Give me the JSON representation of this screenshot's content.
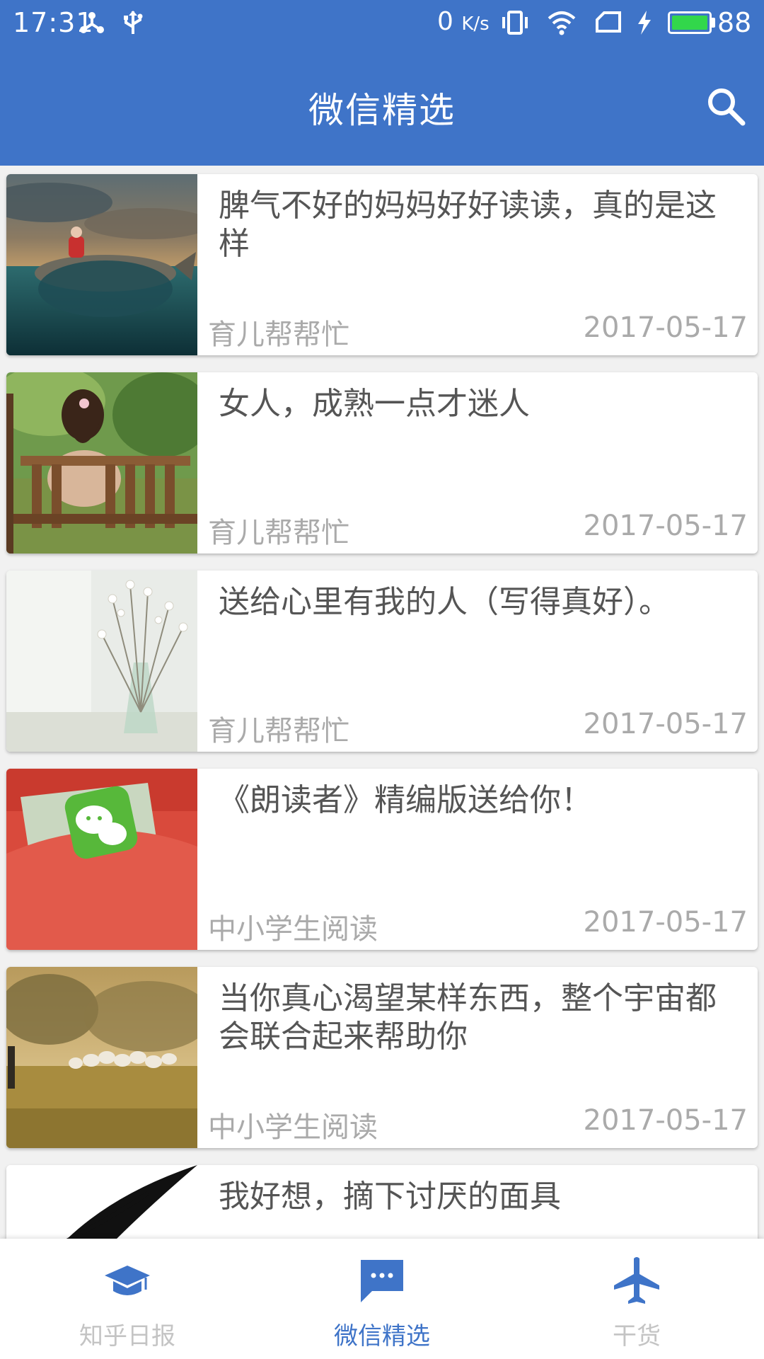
{
  "status_bar": {
    "time": "17:31",
    "net_speed_value": "0",
    "net_speed_unit": "K/s",
    "battery_level": "88",
    "icons": [
      "share-nodes-icon",
      "usb-icon",
      "vibrate-icon",
      "wifi-icon",
      "no-sim-icon",
      "charging-icon",
      "battery-icon"
    ]
  },
  "app_bar": {
    "title": "微信精选",
    "search_icon": "search-icon"
  },
  "articles": [
    {
      "title": "脾气不好的妈妈好好读读，真的是这样",
      "source": "育儿帮帮忙",
      "date": "2017-05-17"
    },
    {
      "title": "女人，成熟一点才迷人",
      "source": "育儿帮帮忙",
      "date": "2017-05-17"
    },
    {
      "title": "送给心里有我的人（写得真好）。",
      "source": "育儿帮帮忙",
      "date": "2017-05-17"
    },
    {
      "title": "《朗读者》精编版送给你！",
      "source": "中小学生阅读",
      "date": "2017-05-17"
    },
    {
      "title": "当你真心渴望某样东西，整个宇宙都会联合起来帮助你",
      "source": "中小学生阅读",
      "date": "2017-05-17"
    },
    {
      "title": "我好想，摘下讨厌的面具",
      "source": "",
      "date": ""
    }
  ],
  "bottom_nav": {
    "tabs": [
      {
        "label": "知乎日报",
        "icon": "graduation-cap-icon"
      },
      {
        "label": "微信精选",
        "icon": "chat-bubble-icon"
      },
      {
        "label": "干货",
        "icon": "airplane-icon"
      }
    ],
    "active_index": 1
  },
  "colors": {
    "primary": "#3f74c8",
    "inactive": "#c4c4c4",
    "battery": "#32d74b"
  }
}
